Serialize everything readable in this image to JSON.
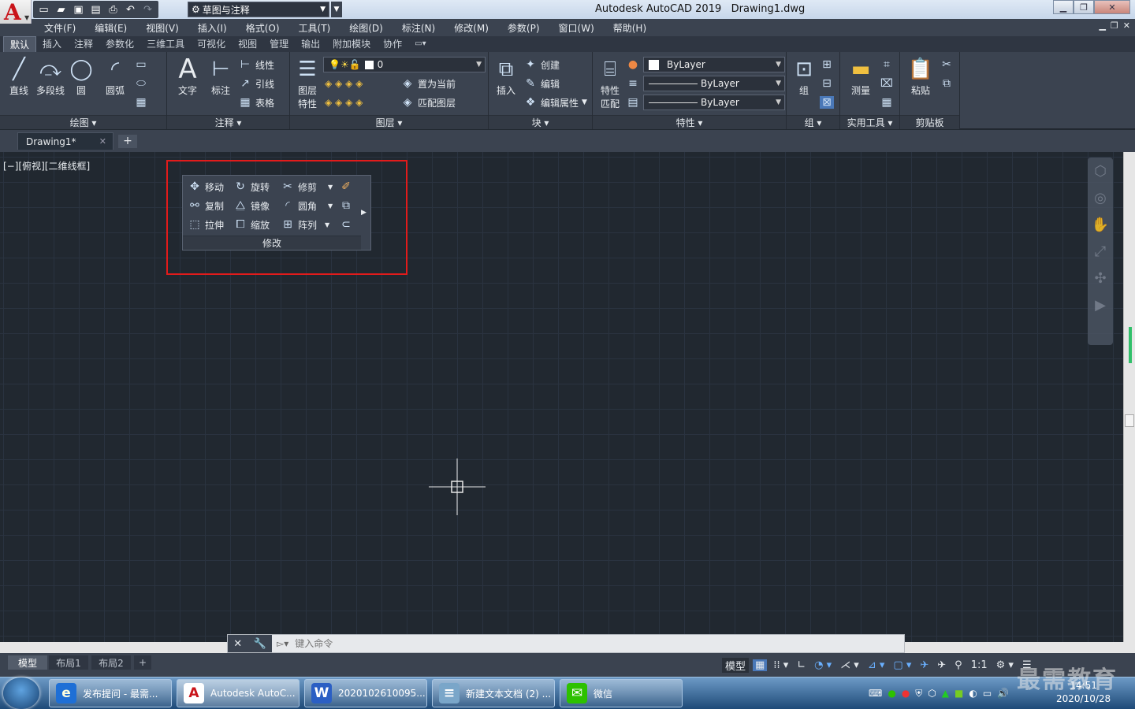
{
  "window": {
    "app_title": "Autodesk AutoCAD 2019",
    "file": "Drawing1.dwg",
    "app_logo": "A"
  },
  "workspace": {
    "value": "草图与注释"
  },
  "menu": [
    "文件(F)",
    "编辑(E)",
    "视图(V)",
    "插入(I)",
    "格式(O)",
    "工具(T)",
    "绘图(D)",
    "标注(N)",
    "修改(M)",
    "参数(P)",
    "窗口(W)",
    "帮助(H)"
  ],
  "ribbon_tabs": [
    "默认",
    "插入",
    "注释",
    "参数化",
    "三维工具",
    "可视化",
    "视图",
    "管理",
    "输出",
    "附加模块",
    "协作"
  ],
  "ribbon": {
    "draw": {
      "title": "绘图",
      "line": "直线",
      "polyline": "多段线",
      "circle": "圆",
      "arc": "圆弧"
    },
    "annotation": {
      "title": "注释",
      "text": "文字",
      "dimension": "标注",
      "linear": "线性",
      "leader": "引线",
      "table": "表格"
    },
    "layers": {
      "title": "图层",
      "props": "图层\n特性",
      "current_layer": "0",
      "set_current": "置为当前",
      "match_layer": "匹配图层"
    },
    "block": {
      "title": "块",
      "insert": "插入",
      "create": "创建",
      "edit": "编辑",
      "edit_attr": "编辑属性"
    },
    "properties": {
      "title": "特性",
      "match": "特性\n匹配",
      "color": "ByLayer",
      "linetype": "ByLayer",
      "lineweight": "ByLayer"
    },
    "groups": {
      "title": "组",
      "group": "组"
    },
    "utilities": {
      "title": "实用工具",
      "measure": "测量"
    },
    "clipboard": {
      "title": "剪贴板",
      "paste": "粘贴"
    }
  },
  "doc_tab": {
    "label": "Drawing1*"
  },
  "viewport_label": "[−][俯视][二维线框]",
  "modify_panel": {
    "title": "修改",
    "move": "移动",
    "rotate": "旋转",
    "trim": "修剪",
    "copy": "复制",
    "mirror": "镜像",
    "fillet": "圆角",
    "stretch": "拉伸",
    "scale": "缩放",
    "array": "阵列"
  },
  "command_line": {
    "placeholder": "键入命令"
  },
  "layout_tabs": [
    "模型",
    "布局1",
    "布局2"
  ],
  "status": {
    "model": "模型",
    "scale": "1:1"
  },
  "taskbar": [
    {
      "label": "发布提问 - 最需...",
      "color": "#1e6fd6",
      "icon": "e"
    },
    {
      "label": "Autodesk AutoC...",
      "color": "#c9141a",
      "icon": "A"
    },
    {
      "label": "2020102610095...",
      "color": "#2b5fc4",
      "icon": "W"
    },
    {
      "label": "新建文本文档 (2) ...",
      "color": "#7aa6c9",
      "icon": "≡"
    },
    {
      "label": "微信",
      "color": "#2dc100",
      "icon": "✉"
    }
  ],
  "clock": {
    "time": "14:51",
    "date": "2020/10/28"
  },
  "watermark": "最需教育"
}
